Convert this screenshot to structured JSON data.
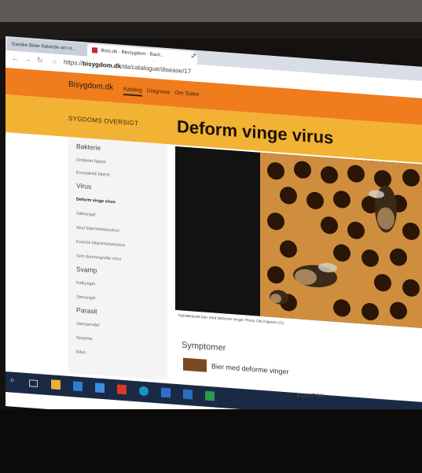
{
  "browser": {
    "tabs": [
      {
        "label": "Danske Bider fiskende om vi..."
      },
      {
        "label": "Bisis.dk - Biissygdom - Bacil..."
      }
    ],
    "url_prefix": "https://",
    "url_domain": "bisygdom.dk",
    "url_path": "/da/catalogue/disease/17",
    "newtab_glyph": "+",
    "close_glyph": "×"
  },
  "header": {
    "brand": "Bisygdom.dk",
    "nav": [
      "Katalog",
      "Diagnose",
      "Om Siden"
    ],
    "active_nav": "Katalog"
  },
  "sidebar": {
    "title": "SYGDOMS OVERSIGT",
    "groups": [
      {
        "label": "Bakterie",
        "items": [
          "Ondartet bipest",
          "Europæisk bipest"
        ]
      },
      {
        "label": "Virus",
        "items": [
          "Deform vinge virus",
          "Sækyngel",
          "Akut bilammelsesvirus",
          "Kronisk bilammelsesvirus",
          "Sort dronningcelle virus"
        ]
      },
      {
        "label": "Svamp",
        "items": [
          "Kalkyngel",
          "Stenyngel"
        ]
      },
      {
        "label": "Parasit",
        "items": [
          "Varroamider",
          "Nosema",
          "Bilus"
        ]
      }
    ],
    "active_item": "Deform vinge virus"
  },
  "main": {
    "title": "Deform vinge virus",
    "caption": "Nyklækkede bier med deforme vinger Photo Ole Kilpinen (C)",
    "section_title": "Symptomer",
    "symptom": "Bier med deforme vinger"
  },
  "monitor": {
    "brand": "FUJITSU"
  },
  "colors": {
    "header": "#f07c1e",
    "band": "#f2b233",
    "sidebar": "#f4f4f4",
    "taskbar": "#1a2a44"
  }
}
